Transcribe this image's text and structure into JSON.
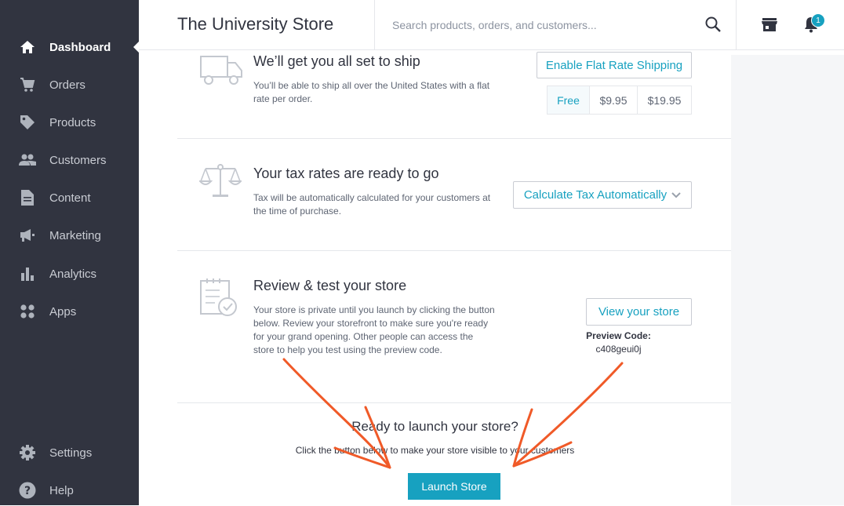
{
  "header": {
    "store_title": "The University Store",
    "search_placeholder": "Search products, orders, and customers...",
    "notification_count": "1"
  },
  "sidebar": {
    "items": [
      {
        "label": "Dashboard",
        "icon": "home-icon",
        "active": true
      },
      {
        "label": "Orders",
        "icon": "cart-icon"
      },
      {
        "label": "Products",
        "icon": "tag-icon"
      },
      {
        "label": "Customers",
        "icon": "people-icon"
      },
      {
        "label": "Content",
        "icon": "document-icon"
      },
      {
        "label": "Marketing",
        "icon": "megaphone-icon"
      },
      {
        "label": "Analytics",
        "icon": "bar-chart-icon"
      },
      {
        "label": "Apps",
        "icon": "apps-grid-icon"
      }
    ],
    "bottom": [
      {
        "label": "Settings",
        "icon": "gear-icon"
      },
      {
        "label": "Help",
        "icon": "help-icon"
      }
    ]
  },
  "shipping": {
    "title": "We’ll get you all set to ship",
    "description": "You’ll be able to ship all over the United States with a flat rate per order.",
    "button": "Enable Flat Rate Shipping",
    "rates": [
      "Free",
      "$9.95",
      "$19.95"
    ],
    "selected_rate": "Free"
  },
  "tax": {
    "title": "Your tax rates are ready to go",
    "description": "Tax will be automatically calculated for your customers at the time of purchase.",
    "button": "Calculate Tax Automatically"
  },
  "review": {
    "title": "Review & test your store",
    "description": "Your store is private until you launch by clicking the button below. Review your storefront to make sure you're ready for your grand opening. Other people can access the store to help you test using the preview code.",
    "button": "View your store",
    "preview_label": "Preview Code:",
    "preview_code": "c408geui0j"
  },
  "launch": {
    "title": "Ready to launch your store?",
    "description": "Click the button below to make your store visible to your customers",
    "button": "Launch Store"
  },
  "colors": {
    "sidebar_bg": "#313440",
    "accent": "#17a1c0",
    "annotation": "#f05a28"
  }
}
